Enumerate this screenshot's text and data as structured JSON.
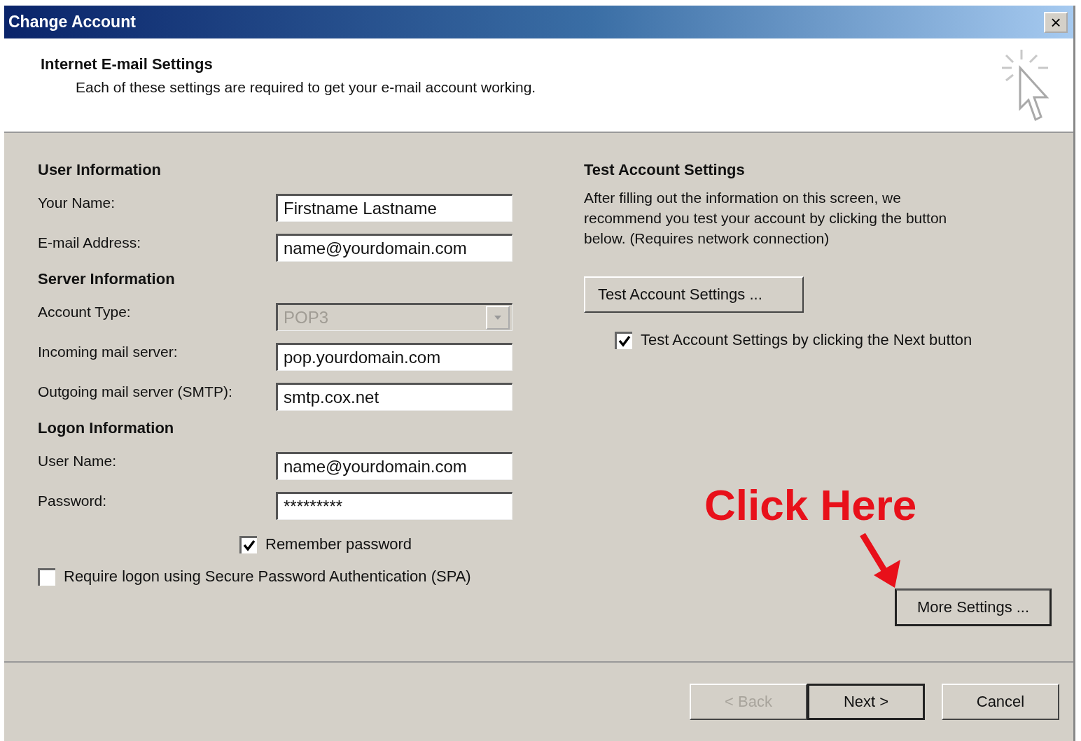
{
  "window": {
    "title": "Change Account",
    "close": "×"
  },
  "header": {
    "title": "Internet E-mail Settings",
    "subtitle": "Each of these settings are required to get your e-mail account working."
  },
  "sections": [
    {
      "title": "User Information",
      "rows": [
        {
          "kind": "field",
          "label": "Your Name:",
          "value": "Firstname Lastname",
          "disabled": false
        },
        {
          "kind": "field",
          "label": "E-mail Address:",
          "value": "name@yourdomain.com",
          "disabled": false
        }
      ]
    },
    {
      "title": "Server Information",
      "rows": [
        {
          "kind": "select",
          "label": "Account Type:",
          "value": "POP3",
          "disabled": true
        },
        {
          "kind": "field",
          "label": "Incoming mail server:",
          "value": "pop.yourdomain.com",
          "disabled": false
        },
        {
          "kind": "field",
          "label": "Outgoing mail server (SMTP):",
          "value": "smtp.cox.net",
          "disabled": false
        }
      ]
    },
    {
      "title": "Logon Information",
      "rows": [
        {
          "kind": "field",
          "label": "User Name:",
          "value": "name@yourdomain.com",
          "disabled": false
        },
        {
          "kind": "field",
          "label": "Password:",
          "value": "*********",
          "disabled": false
        },
        {
          "kind": "checkbox",
          "label": "Remember password",
          "checked": true
        },
        {
          "kind": "checkbox",
          "label": "Require logon using Secure Password Authentication (SPA)",
          "checked": false
        }
      ]
    }
  ],
  "test": {
    "title": "Test Account Settings",
    "description": "After filling out the information on this screen, we recommend you test your account by clicking the button below. (Requires network connection)",
    "button": "Test Account Settings ...",
    "checkbox": {
      "label": "Test Account Settings by clicking the Next button",
      "checked": true
    }
  },
  "annotation": "Click Here",
  "more_settings": "More Settings ...",
  "buttons": [
    {
      "label": "< Back",
      "disabled": true,
      "default": false
    },
    {
      "label": "Next >",
      "disabled": false,
      "default": true
    },
    {
      "label": "Cancel",
      "disabled": false,
      "default": false
    }
  ]
}
